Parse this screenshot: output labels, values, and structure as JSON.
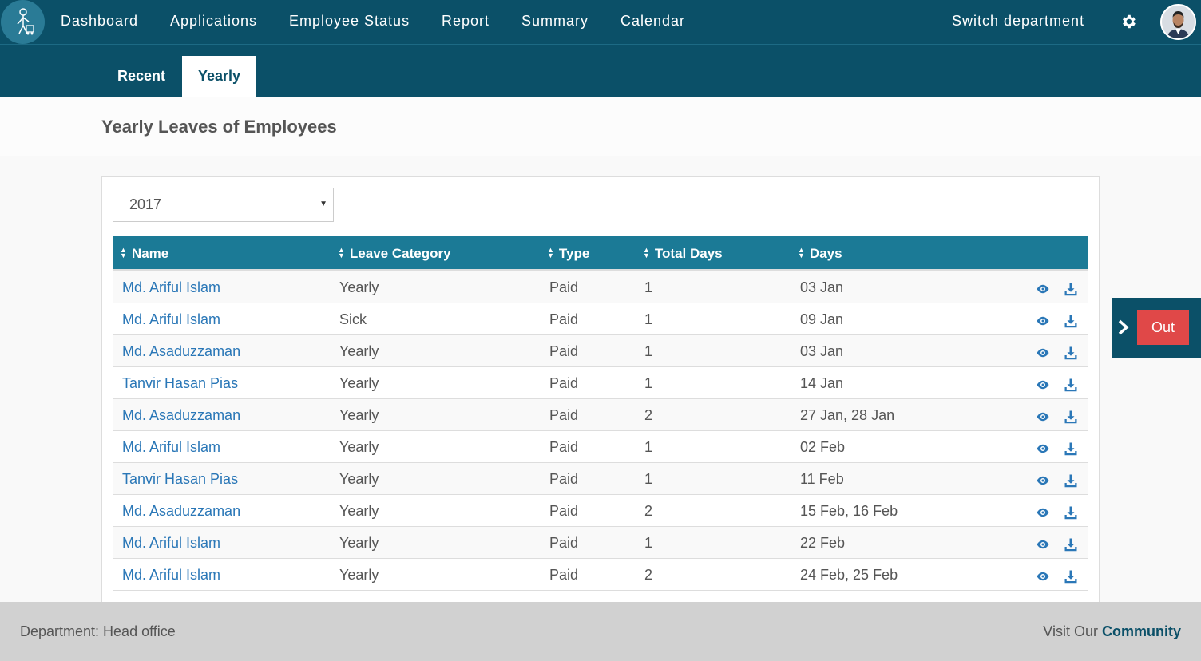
{
  "nav": {
    "items": [
      "Dashboard",
      "Applications",
      "Employee Status",
      "Report",
      "Summary",
      "Calendar"
    ],
    "switch_department": "Switch department"
  },
  "tabs": {
    "recent": "Recent",
    "yearly": "Yearly"
  },
  "page_title": "Yearly Leaves of Employees",
  "year_select": {
    "value": "2017"
  },
  "table": {
    "headers": {
      "name": "Name",
      "category": "Leave Category",
      "type": "Type",
      "total": "Total Days",
      "days": "Days"
    },
    "rows": [
      {
        "name": "Md. Ariful Islam",
        "category": "Yearly",
        "type": "Paid",
        "total": "1",
        "days": "03 Jan"
      },
      {
        "name": "Md. Ariful Islam",
        "category": "Sick",
        "type": "Paid",
        "total": "1",
        "days": "09 Jan"
      },
      {
        "name": "Md. Asaduzzaman",
        "category": "Yearly",
        "type": "Paid",
        "total": "1",
        "days": "03 Jan"
      },
      {
        "name": "Tanvir Hasan Pias",
        "category": "Yearly",
        "type": "Paid",
        "total": "1",
        "days": "14 Jan"
      },
      {
        "name": "Md. Asaduzzaman",
        "category": "Yearly",
        "type": "Paid",
        "total": "2",
        "days": "27 Jan, 28 Jan"
      },
      {
        "name": "Md. Ariful Islam",
        "category": "Yearly",
        "type": "Paid",
        "total": "1",
        "days": "02 Feb"
      },
      {
        "name": "Tanvir Hasan Pias",
        "category": "Yearly",
        "type": "Paid",
        "total": "1",
        "days": "11 Feb"
      },
      {
        "name": "Md. Asaduzzaman",
        "category": "Yearly",
        "type": "Paid",
        "total": "2",
        "days": "15 Feb, 16 Feb"
      },
      {
        "name": "Md. Ariful Islam",
        "category": "Yearly",
        "type": "Paid",
        "total": "1",
        "days": "22 Feb"
      },
      {
        "name": "Md. Ariful Islam",
        "category": "Yearly",
        "type": "Paid",
        "total": "2",
        "days": "24 Feb, 25 Feb"
      }
    ],
    "row_icons": [
      "eye-icon",
      "download-icon"
    ]
  },
  "side_panel": {
    "out_label": "Out"
  },
  "footer": {
    "department": "Department: Head office",
    "visit_text": "Visit Our",
    "community": "Community"
  },
  "colors": {
    "header_bg": "#0b5068",
    "table_header_bg": "#1b7a96",
    "link": "#2a77b7",
    "out_button": "#e04848",
    "footer_bg": "#d1d1d1"
  }
}
